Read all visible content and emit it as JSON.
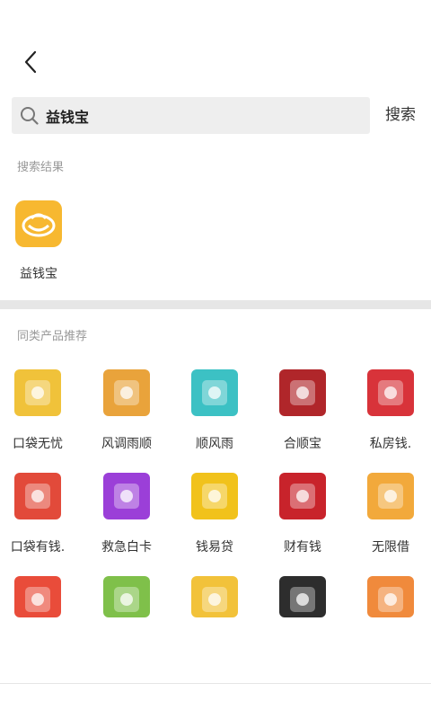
{
  "search": {
    "value": "益钱宝",
    "button_label": "搜索"
  },
  "sections": {
    "results_label": "搜索结果",
    "similar_label": "同类产品推荐"
  },
  "result": {
    "name": "益钱宝",
    "icon": "yiqianbao-icon",
    "color": "#f7b830"
  },
  "similar_apps": [
    {
      "name": "口袋无忧",
      "icon": "koudai-wuyou-icon",
      "color": "#f0c23a"
    },
    {
      "name": "风调雨顺",
      "icon": "fengtiao-yushun-icon",
      "color": "#e9a33b"
    },
    {
      "name": "顺风雨",
      "icon": "shunfengyu-icon",
      "color": "#3cc1c4"
    },
    {
      "name": "合顺宝",
      "icon": "heshunbao-icon",
      "color": "#b0262a"
    },
    {
      "name": "私房钱.",
      "icon": "sifangqian-icon",
      "color": "#d8333a"
    },
    {
      "name": "口袋有钱.",
      "icon": "koudai-youqian-icon",
      "color": "#e24a3a"
    },
    {
      "name": "救急白卡",
      "icon": "jiuji-baika-icon",
      "color": "#9b3fd8"
    },
    {
      "name": "钱易贷",
      "icon": "qianyidai-icon",
      "color": "#f1c21b"
    },
    {
      "name": "财有钱",
      "icon": "caiyouqian-icon",
      "color": "#c8232b"
    },
    {
      "name": "无限借",
      "icon": "wuxianjie-icon",
      "color": "#f2a93b"
    },
    {
      "name": "",
      "icon": "wallet-app-icon",
      "color": "#e94c3a"
    },
    {
      "name": "",
      "icon": "plant-app-icon",
      "color": "#7fc04a"
    },
    {
      "name": "",
      "icon": "pattern-app-icon",
      "color": "#f2c23a"
    },
    {
      "name": "",
      "icon": "dark-app-icon",
      "color": "#2d2d2d"
    },
    {
      "name": "",
      "icon": "orange-app-icon",
      "color": "#f08a3c"
    }
  ]
}
